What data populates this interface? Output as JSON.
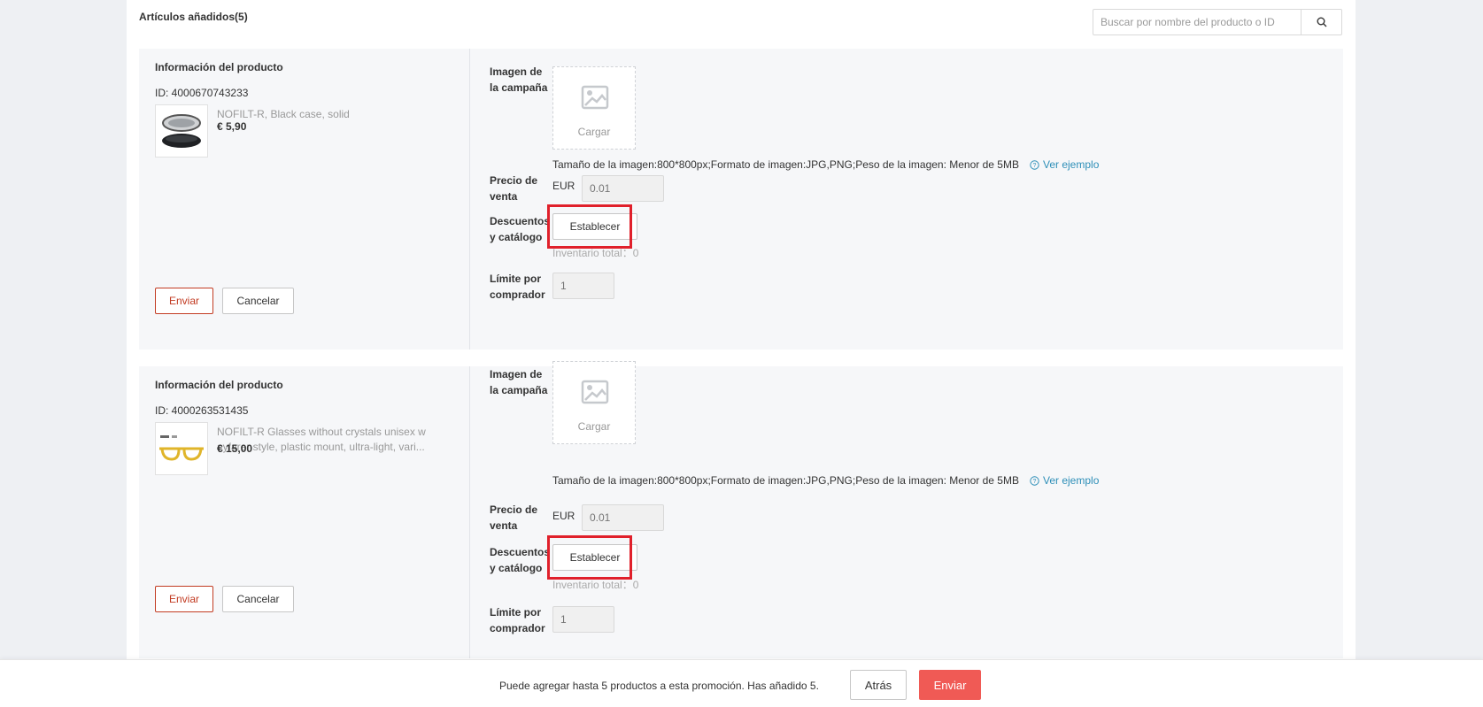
{
  "header": {
    "title": "Artículos añadidos(5)",
    "search_placeholder": "Buscar por nombre del producto o ID"
  },
  "products": [
    {
      "info_title": "Información del producto",
      "id_text": "ID: 4000670743233",
      "name": "NOFILT-R, Black case, solid",
      "price": "€ 5,90",
      "submit_label": "Enviar",
      "cancel_label": "Cancelar",
      "campaign_image_label": "Imagen de la campaña",
      "upload_label": "Cargar",
      "size_hint": "Tamaño de la imagen:800*800px;Formato de imagen:JPG,PNG;Peso de la imagen: Menor de 5MB",
      "example_link": "Ver ejemplo",
      "sale_price_label": "Precio de venta",
      "currency": "EUR",
      "price_placeholder": "0.01",
      "discount_label": "Descuentos y catálogo",
      "set_label": "Establecer",
      "inventory_text": "Inventario total：0",
      "limit_label": "Límite por comprador",
      "limit_placeholder": "1"
    },
    {
      "info_title": "Información del producto",
      "id_text": "ID: 4000263531435",
      "name": "NOFILT-R Glasses without crystals unisex w ayfarer style, plastic mount, ultra-light, vari...",
      "price": "€ 15,00",
      "submit_label": "Enviar",
      "cancel_label": "Cancelar",
      "campaign_image_label": "Imagen de la campaña",
      "upload_label": "Cargar",
      "size_hint": "Tamaño de la imagen:800*800px;Formato de imagen:JPG,PNG;Peso de la imagen: Menor de 5MB",
      "example_link": "Ver ejemplo",
      "sale_price_label": "Precio de venta",
      "currency": "EUR",
      "price_placeholder": "0.01",
      "discount_label": "Descuentos y catálogo",
      "set_label": "Establecer",
      "inventory_text": "Inventario total：0",
      "limit_label": "Límite por comprador",
      "limit_placeholder": "1"
    }
  ],
  "footer": {
    "message": "Puede agregar hasta 5 productos a esta promoción. Has añadido 5.",
    "back_label": "Atrás",
    "submit_label": "Enviar"
  },
  "colors": {
    "highlight": "#e0202b",
    "primary": "#f05a55",
    "link": "#2e8fb8"
  }
}
